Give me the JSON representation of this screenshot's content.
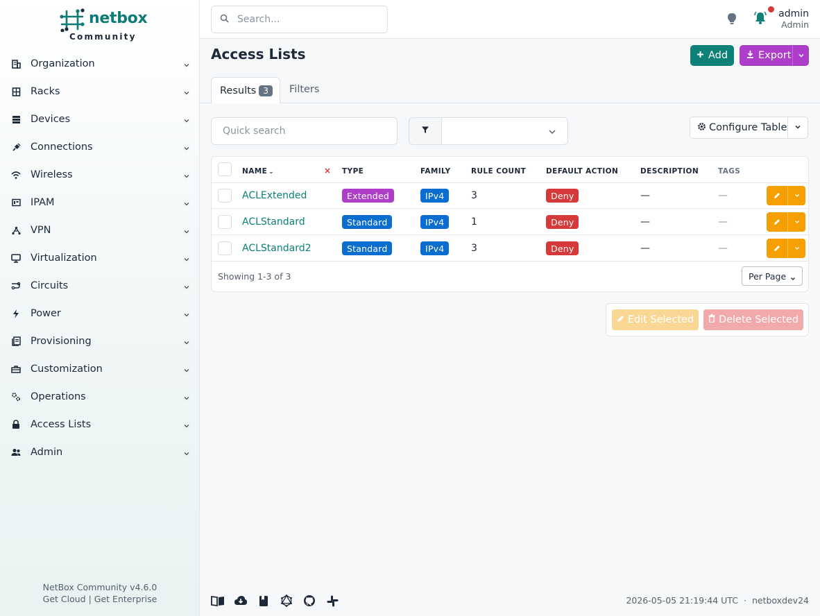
{
  "brand": {
    "name": "netbox",
    "edition": "Community"
  },
  "sidebar": {
    "items": [
      {
        "label": "Organization"
      },
      {
        "label": "Racks"
      },
      {
        "label": "Devices"
      },
      {
        "label": "Connections"
      },
      {
        "label": "Wireless"
      },
      {
        "label": "IPAM"
      },
      {
        "label": "VPN"
      },
      {
        "label": "Virtualization"
      },
      {
        "label": "Circuits"
      },
      {
        "label": "Power"
      },
      {
        "label": "Provisioning"
      },
      {
        "label": "Customization"
      },
      {
        "label": "Operations"
      },
      {
        "label": "Access Lists"
      },
      {
        "label": "Admin"
      }
    ],
    "footer": {
      "version": "NetBox Community v4.6.0",
      "cloud": "Get Cloud",
      "sep": "|",
      "enterprise": "Get Enterprise"
    }
  },
  "topbar": {
    "search_placeholder": "Search...",
    "user": {
      "name": "admin",
      "role": "Admin"
    }
  },
  "page": {
    "title": "Access Lists",
    "add_label": "Add",
    "export_label": "Export",
    "tabs": {
      "results_label": "Results",
      "results_count": "3",
      "filters_label": "Filters"
    }
  },
  "toolbar": {
    "quick_search_placeholder": "Quick search",
    "configure_label": "Configure Table"
  },
  "table": {
    "columns": {
      "name": "NAME",
      "clear": "×",
      "type": "TYPE",
      "family": "FAMILY",
      "rule_count": "RULE COUNT",
      "default_action": "DEFAULT ACTION",
      "description": "DESCRIPTION",
      "tags": "TAGS"
    },
    "rows": [
      {
        "name": "ACLExtended",
        "type": "Extended",
        "family": "IPv4",
        "rule_count": "3",
        "default_action": "Deny",
        "description": "—",
        "tags": "—"
      },
      {
        "name": "ACLStandard",
        "type": "Standard",
        "family": "IPv4",
        "rule_count": "1",
        "default_action": "Deny",
        "description": "—",
        "tags": "—"
      },
      {
        "name": "ACLStandard2",
        "type": "Standard",
        "family": "IPv4",
        "rule_count": "3",
        "default_action": "Deny",
        "description": "—",
        "tags": "—"
      }
    ],
    "showing": "Showing 1-3 of 3",
    "per_page_label": "Per Page"
  },
  "bulk": {
    "edit_label": "Edit Selected",
    "delete_label": "Delete Selected"
  },
  "footer": {
    "timestamp": "2026-05-05 21:19:44 UTC",
    "dot": "·",
    "hostname": "netboxdev24"
  },
  "colors": {
    "accent": "#0d8077",
    "export": "#ae3ec9",
    "type_extended": "#ae3ec9",
    "type_standard": "#0a6ed1",
    "family": "#0a6ed1",
    "deny": "#d63939",
    "action": "#f59f00"
  }
}
